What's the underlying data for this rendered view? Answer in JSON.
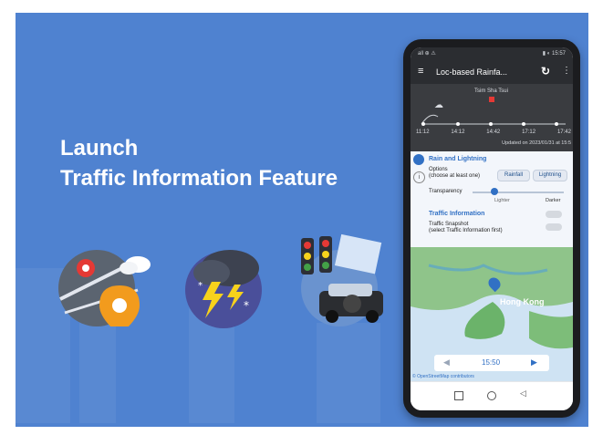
{
  "headline": {
    "line1": "Launch",
    "line2": "Traffic Information Feature"
  },
  "phone": {
    "status_left": "all ⊕ ⚠",
    "status_right": "▮ ◐ 15:57",
    "app_title": "Loc-based Rainfa...",
    "location_label": "Tsim Sha Tsui",
    "timeline_ticks": [
      "11:12",
      "14:12",
      "14:42",
      "17:12",
      "17:42"
    ],
    "updated_text": "Updated on 2023/01/31 at 15:5",
    "panel": {
      "section1_title": "Rain and Lightning",
      "options_label": "Options\n(choose at least one)",
      "rainfall_button": "Rainfall",
      "lightning_button": "Lightning",
      "transparency_label": "Transparency",
      "lighter": "Lighter",
      "darker": "Darker",
      "section2_title": "Traffic Information",
      "traffic_snapshot": "Traffic Snapshot\n(select Traffic Information first)"
    },
    "map": {
      "place_label": "Hong Kong",
      "player_time": "15:50",
      "attribution": "© OpenStreetMap contributors"
    }
  },
  "colors": {
    "background": "#4f82d0",
    "accent_blue": "#3170c4",
    "phone_dark": "#2b2d31"
  }
}
